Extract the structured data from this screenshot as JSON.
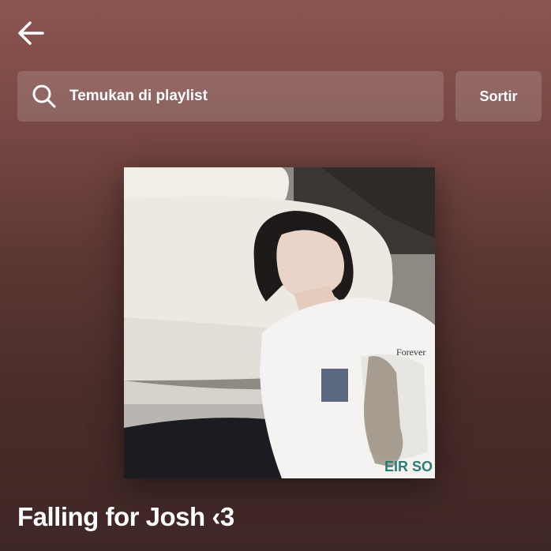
{
  "header": {
    "back_icon": "arrow-left-icon"
  },
  "search": {
    "icon": "search-icon",
    "placeholder": "Temukan di playlist"
  },
  "sort": {
    "label": "Sortir"
  },
  "playlist": {
    "cover_description_icon": "playlist-cover-image",
    "title": "Falling for Josh ‹3"
  },
  "colors": {
    "background_top": "#8c5550",
    "background_bottom": "#3f2725",
    "control_background": "rgba(255,255,255,0.15)",
    "text": "#ffffff"
  }
}
